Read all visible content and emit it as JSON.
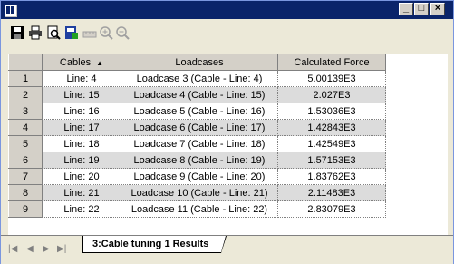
{
  "table": {
    "columns": [
      "",
      "Cables",
      "Loadcases",
      "Calculated Force"
    ],
    "sort_indicator": "▲",
    "rows": [
      {
        "num": "1",
        "cable": "Line: 4",
        "loadcase": "Loadcase 3 (Cable - Line: 4)",
        "force": "5.00139E3"
      },
      {
        "num": "2",
        "cable": "Line: 15",
        "loadcase": "Loadcase 4 (Cable - Line: 15)",
        "force": "2.027E3"
      },
      {
        "num": "3",
        "cable": "Line: 16",
        "loadcase": "Loadcase 5 (Cable - Line: 16)",
        "force": "1.53036E3"
      },
      {
        "num": "4",
        "cable": "Line: 17",
        "loadcase": "Loadcase 6 (Cable - Line: 17)",
        "force": "1.42843E3"
      },
      {
        "num": "5",
        "cable": "Line: 18",
        "loadcase": "Loadcase 7 (Cable - Line: 18)",
        "force": "1.42549E3"
      },
      {
        "num": "6",
        "cable": "Line: 19",
        "loadcase": "Loadcase 8 (Cable - Line: 19)",
        "force": "1.57153E3"
      },
      {
        "num": "7",
        "cable": "Line: 20",
        "loadcase": "Loadcase 9 (Cable - Line: 20)",
        "force": "1.83762E3"
      },
      {
        "num": "8",
        "cable": "Line: 21",
        "loadcase": "Loadcase 10 (Cable - Line: 21)",
        "force": "2.11483E3"
      },
      {
        "num": "9",
        "cable": "Line: 22",
        "loadcase": "Loadcase 11 (Cable - Line: 22)",
        "force": "2.83079E3"
      }
    ]
  },
  "tabs": {
    "active_label": "3:Cable tuning 1 Results"
  },
  "toolbar": {
    "icons": [
      "save-icon",
      "print-icon",
      "print-preview-icon",
      "export-icon",
      "ruler-icon",
      "zoom-in-icon",
      "zoom-out-icon"
    ]
  }
}
